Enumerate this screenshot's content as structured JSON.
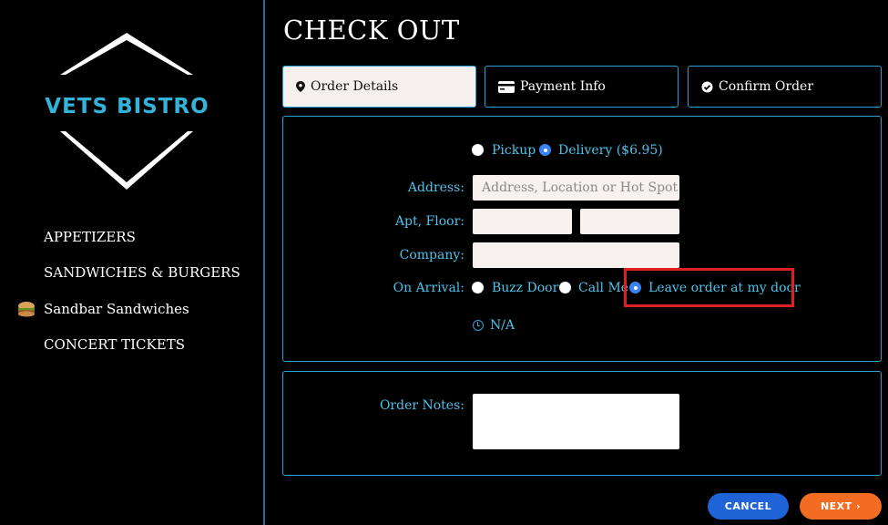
{
  "brand": {
    "name": "VETS BISTRO"
  },
  "sidebar": {
    "items": [
      {
        "label": "APPETIZERS",
        "icon": ""
      },
      {
        "label": "SANDWICHES & BURGERS",
        "icon": ""
      },
      {
        "label": "Sandbar Sandwiches",
        "icon": "sandwich-icon"
      },
      {
        "label": "CONCERT TICKETS",
        "icon": ""
      }
    ]
  },
  "page": {
    "title": "CHECK OUT"
  },
  "tabs": [
    {
      "label": "Order Details",
      "icon": "map-pin-icon",
      "active": true
    },
    {
      "label": "Payment Info",
      "icon": "credit-card-icon",
      "active": false
    },
    {
      "label": "Confirm Order",
      "icon": "check-circle-icon",
      "active": false
    }
  ],
  "order": {
    "method": {
      "options": [
        {
          "label": "Pickup",
          "checked": false
        },
        {
          "label": "Delivery ($6.95)",
          "checked": true
        }
      ]
    },
    "address": {
      "label": "Address:",
      "placeholder": "Address, Location or Hot Spot",
      "value": ""
    },
    "apt": {
      "label": "Apt, Floor:",
      "value1": "",
      "value2": ""
    },
    "company": {
      "label": "Company:",
      "value": ""
    },
    "arrival": {
      "label": "On Arrival:",
      "options": [
        {
          "label": "Buzz Door",
          "checked": false
        },
        {
          "label": "Call Me",
          "checked": false
        },
        {
          "label": "Leave order at my door",
          "checked": true
        }
      ]
    },
    "na_label": "N/A"
  },
  "notes": {
    "label": "Order Notes:",
    "value": ""
  },
  "buttons": {
    "cancel": "CANCEL",
    "next": "NEXT ›"
  },
  "colors": {
    "accent": "#2a9fd6",
    "label": "#4fc3ea",
    "cancel": "#1f63d6",
    "next": "#f26c22",
    "highlight": "#e02020"
  }
}
